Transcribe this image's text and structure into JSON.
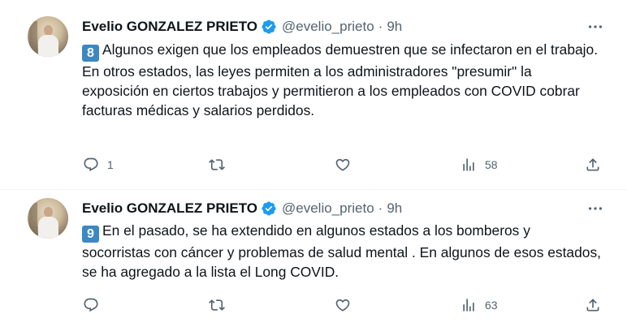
{
  "tweets": [
    {
      "author": {
        "name": "Evelio GONZALEZ PRIETO",
        "handle": "@evelio_prieto"
      },
      "separator": "·",
      "time": "9h",
      "keycap": "8",
      "lines": [
        "Algunos exigen que los empleados demuestren que se infectaron en el trabajo.",
        "En otros estados, las leyes permiten a los administradores \"presumir\" la exposición en ciertos trabajos y permitieron a los empleados con COVID cobrar facturas médicas y salarios perdidos."
      ],
      "replies": "1",
      "retweets": "",
      "likes": "",
      "views": "58"
    },
    {
      "author": {
        "name": "Evelio GONZALEZ PRIETO",
        "handle": "@evelio_prieto"
      },
      "separator": "·",
      "time": "9h",
      "keycap": "9",
      "lines": [
        "En el pasado, se ha extendido en algunos estados a los bomberos y socorristas con cáncer y problemas de salud mental . En algunos de esos estados, se ha agregado a la lista el Long COVID."
      ],
      "replies": "",
      "retweets": "",
      "likes": "",
      "views": "63"
    }
  ],
  "colors": {
    "text": "#0f1419",
    "secondary": "#536471",
    "verified": "#1d9bf0",
    "keycap": "#3b88c3",
    "divider": "#eff3f4"
  },
  "icons": [
    "verified-badge-icon",
    "more-icon",
    "reply-icon",
    "retweet-icon",
    "like-icon",
    "views-icon",
    "share-icon"
  ]
}
